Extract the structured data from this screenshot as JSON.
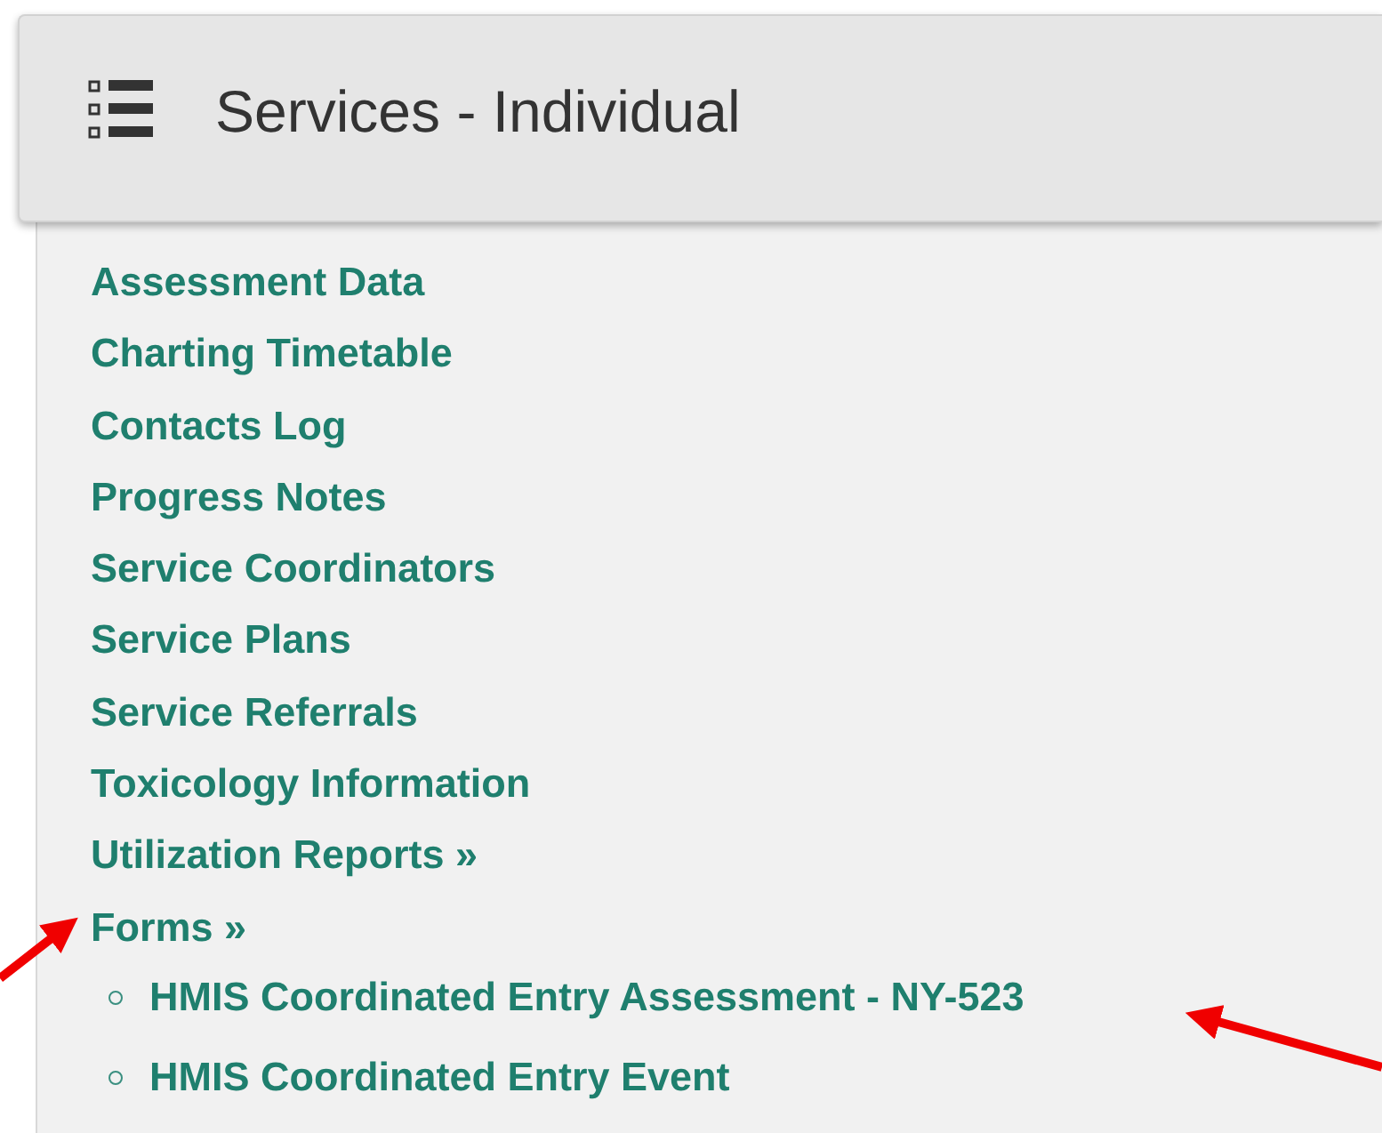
{
  "header": {
    "title": "Services - Individual"
  },
  "menu": {
    "items": [
      {
        "label": "Assessment Data"
      },
      {
        "label": "Charting Timetable"
      },
      {
        "label": "Contacts Log"
      },
      {
        "label": "Progress Notes"
      },
      {
        "label": "Service Coordinators"
      },
      {
        "label": "Service Plans"
      },
      {
        "label": "Service Referrals"
      },
      {
        "label": "Toxicology Information"
      },
      {
        "label": "Utilization Reports »"
      },
      {
        "label": "Forms »",
        "children": [
          {
            "label": "HMIS Coordinated Entry Assessment - NY-523"
          },
          {
            "label": "HMIS Coordinated Entry Event"
          }
        ]
      }
    ]
  }
}
